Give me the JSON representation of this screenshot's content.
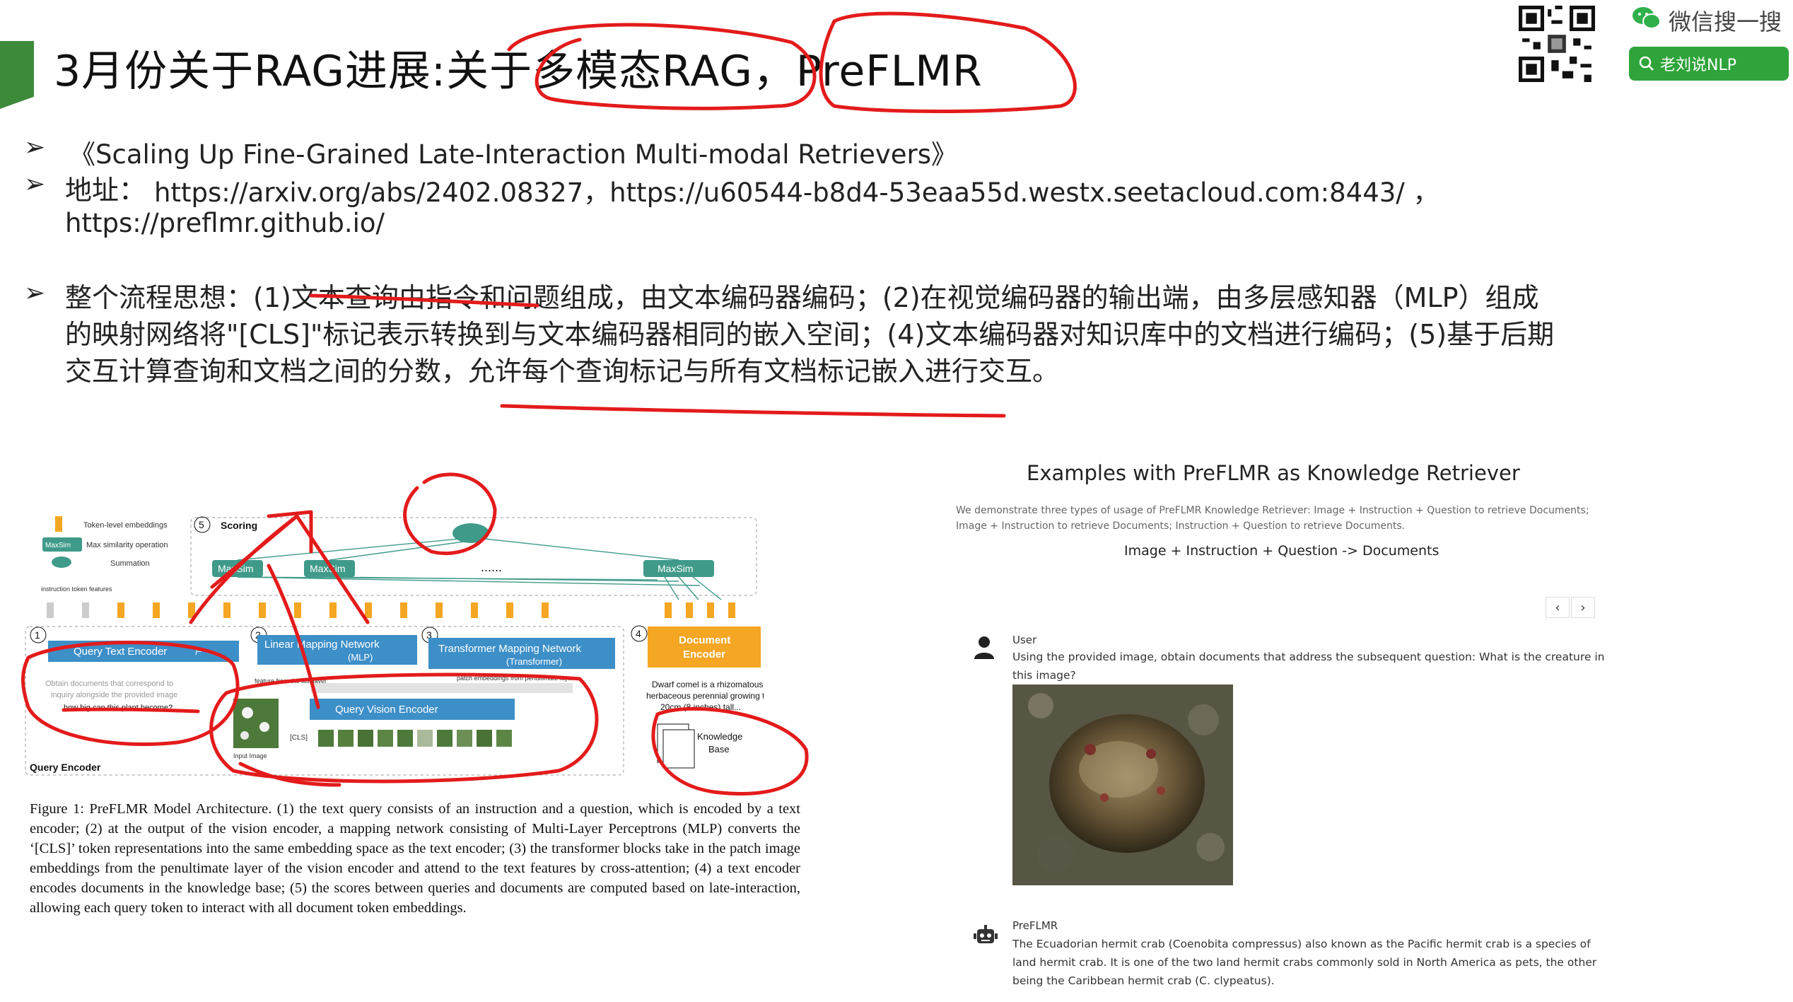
{
  "title": "3月份关于RAG进展:关于多模态RAG，PreFLMR",
  "wechat": {
    "label": "微信搜一搜",
    "search_text": "老刘说NLP"
  },
  "bullets": {
    "paper": "《Scaling Up Fine-Grained Late-Interaction Multi-modal Retrievers》",
    "address_prefix": "地址：",
    "address_line1": "https://arxiv.org/abs/2402.08327，https://u60544-b8d4-53eaa55d.westx.seetacloud.com:8443/ ，",
    "address_line2": "https://preflmr.github.io/",
    "flow_line1": "整个流程思想：(1)文本查询由指令和问题组成，由文本编码器编码；(2)在视觉编码器的输出端，由多层感知器（MLP）组成",
    "flow_line2": "的映射网络将\"[CLS]\"标记表示转换到与文本编码器相同的嵌入空间；(4)文本编码器对知识库中的文档进行编码；(5)基于后期",
    "flow_line3": "交互计算查询和文档之间的分数，允许每个查询标记与所有文档标记嵌入进行交互。"
  },
  "figure": {
    "legend_token": "Token-level embeddings",
    "legend_maxsim_badge": "MaxSim",
    "legend_maxsim": "Max similarity operation",
    "legend_sum": "Summation",
    "scoring_num": "5",
    "scoring": "Scoring",
    "maxsim": "MaxSim",
    "ellipsis": "......",
    "instruction_features": "instruction token features",
    "n1": "1",
    "n2": "2",
    "n3": "3",
    "n4": "4",
    "query_text_encoder": "Query Text Encoder",
    "fl_sym": "F",
    "linear_mapping": "Linear Mapping Network",
    "linear_sub": "(MLP)",
    "transformer_mapping": "Transformer Mapping Network",
    "transformer_sub": "(Transformer)",
    "document_encoder_1": "Document",
    "document_encoder_2": "Encoder",
    "query_text_1": "Obtain documents that correspond to",
    "query_text_2": "inquiry alongside the provided image",
    "query_text_3": "how big can this plant become?",
    "feature_last": "feature from the last layer",
    "patch_embeddings": "patch embeddings from penultimate layer",
    "query_vision_encoder": "Query Vision Encoder",
    "cls": "[CLS]",
    "input_image": "Input Image",
    "query_encoder": "Query Encoder",
    "doc_text_1": "Dwarf comel is a rhizomatous",
    "doc_text_2": "herbaceous perennial growing to",
    "doc_text_3": "20cm (8 inches) tall...",
    "knowledge_base_1": "Knowledge",
    "knowledge_base_2": "Base"
  },
  "caption": "Figure 1: PreFLMR Model Architecture. (1) the text query consists of an instruction and a question, which is encoded by a text encoder; (2) at the output of the vision encoder, a mapping network consisting of Multi-Layer Perceptrons (MLP) converts the ‘[CLS]’ token representations into the same embedding space as the text encoder; (3) the transformer blocks take in the patch image embeddings from the penultimate layer of the vision encoder and attend to the text features by cross-attention; (4) a text encoder encodes documents in the knowledge base; (5) the scores between queries and documents are computed based on late-interaction, allowing each query token to interact with all document token embeddings.",
  "examples": {
    "title": "Examples with PreFLMR as Knowledge Retriever",
    "desc_line1": "We demonstrate three types of usage of PreFLMR Knowledge Retriever: Image + Instruction + Question to retrieve Documents;",
    "desc_line2": "Image + Instruction to retrieve Documents; Instruction + Question to retrieve Documents.",
    "subtitle": "Image + Instruction + Question -> Documents",
    "prev": "‹",
    "next": "›",
    "user_role": "User",
    "user_msg_1": "Using the provided image, obtain documents that address the subsequent question: What is the creature in",
    "user_msg_2": "this image?",
    "bot_role": "PreFLMR",
    "bot_msg_1": "The Ecuadorian hermit crab (Coenobita compressus) also known as the Pacific hermit crab is a species of",
    "bot_msg_2": "land hermit crab. It is one of the two land hermit crabs commonly sold in North America as pets, the other",
    "bot_msg_3": "being the Caribbean hermit crab (C. clypeatus)."
  },
  "colors": {
    "accent": "#3d8a3a",
    "blue": "#3d8fc8",
    "orange": "#f5a623",
    "teal": "#3f9a8a",
    "annotation": "#e31b1b"
  }
}
